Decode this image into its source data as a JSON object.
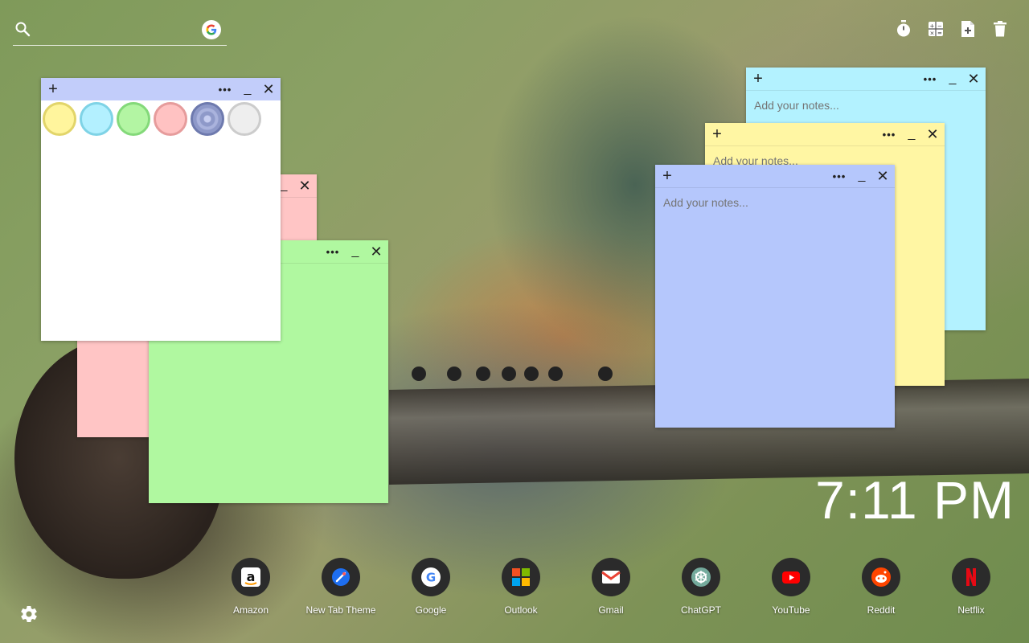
{
  "search": {
    "value": "",
    "placeholder": ""
  },
  "toolbar": {
    "icons": [
      "timer-icon",
      "calculator-icon",
      "new-note-icon",
      "trash-icon"
    ]
  },
  "notes": {
    "placeholder": "Add your notes...",
    "color_picker": {
      "colors": [
        "#fff59d",
        "#b3f0ff",
        "#b3f5a3",
        "#ffc2c2",
        "#8e99c9",
        "#eeeeee"
      ],
      "selected_index": 4
    },
    "colors": {
      "white": "#ffffff",
      "pink": "#ffc5c5",
      "green": "#b0f8a0",
      "blue": "#b5c7fc",
      "yellow": "#fff6a3",
      "cyan": "#b3f2ff",
      "picker_bar": "#c2cdfa"
    }
  },
  "clock": {
    "time": "7:11 PM"
  },
  "dock": {
    "apps": [
      {
        "label": "Amazon",
        "icon": "amazon-icon"
      },
      {
        "label": "New Tab Theme",
        "icon": "new-tab-theme-icon"
      },
      {
        "label": "Google",
        "icon": "google-icon"
      },
      {
        "label": "Outlook",
        "icon": "outlook-icon"
      },
      {
        "label": "Gmail",
        "icon": "gmail-icon"
      },
      {
        "label": "ChatGPT",
        "icon": "chatgpt-icon"
      },
      {
        "label": "YouTube",
        "icon": "youtube-icon"
      },
      {
        "label": "Reddit",
        "icon": "reddit-icon"
      },
      {
        "label": "Netflix",
        "icon": "netflix-icon"
      }
    ]
  }
}
